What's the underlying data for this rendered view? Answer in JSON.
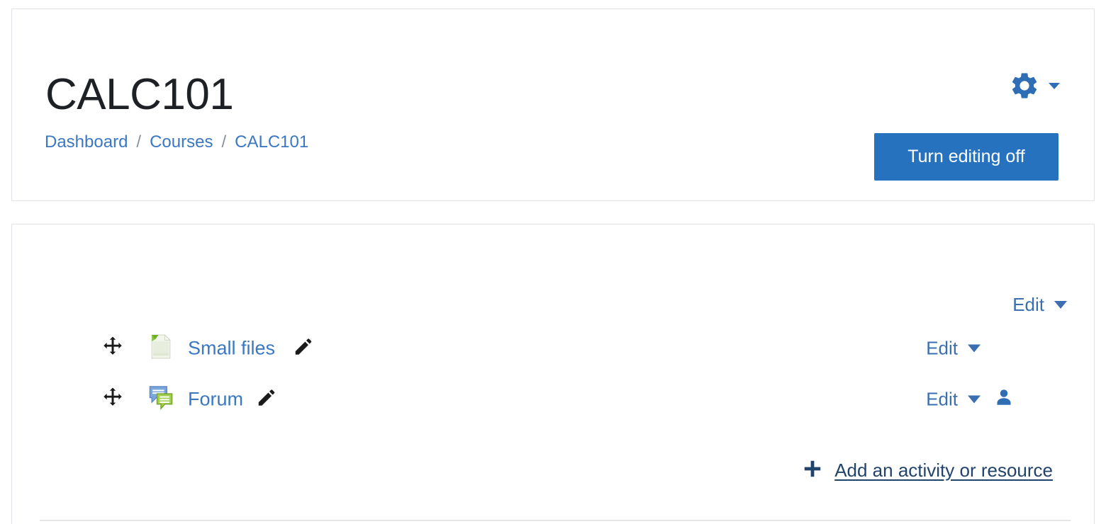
{
  "header": {
    "course_title": "CALC101",
    "breadcrumb": [
      {
        "label": "Dashboard"
      },
      {
        "label": "Courses"
      },
      {
        "label": "CALC101"
      }
    ],
    "breadcrumb_separator": "/",
    "settings_icon": "gear-icon",
    "settings_caret_icon": "chevron-down-icon",
    "editing_button_label": "Turn editing off",
    "editing_button_color": "#2672bf"
  },
  "section": {
    "section_edit_label": "Edit",
    "section_edit_caret_icon": "chevron-down-icon",
    "activities": [
      {
        "name": "Small files",
        "icon": "resource-page-icon",
        "move_icon": "move-arrows-icon",
        "edit_pencil_icon": "pencil-icon",
        "edit_menu_label": "Edit",
        "edit_menu_caret_icon": "chevron-down-icon",
        "has_group_icon": false
      },
      {
        "name": "Forum",
        "icon": "forum-speech-bubbles-icon",
        "move_icon": "move-arrows-icon",
        "edit_pencil_icon": "pencil-icon",
        "edit_menu_label": "Edit",
        "edit_menu_caret_icon": "chevron-down-icon",
        "has_group_icon": true,
        "group_icon": "user-icon"
      }
    ],
    "add_activity": {
      "label": "Add an activity or resource",
      "icon": "plus-icon",
      "color": "#22446b"
    }
  },
  "theme": {
    "link_color": "#3b78c3",
    "card_border": "#dee2e6",
    "text_color": "#212529"
  }
}
